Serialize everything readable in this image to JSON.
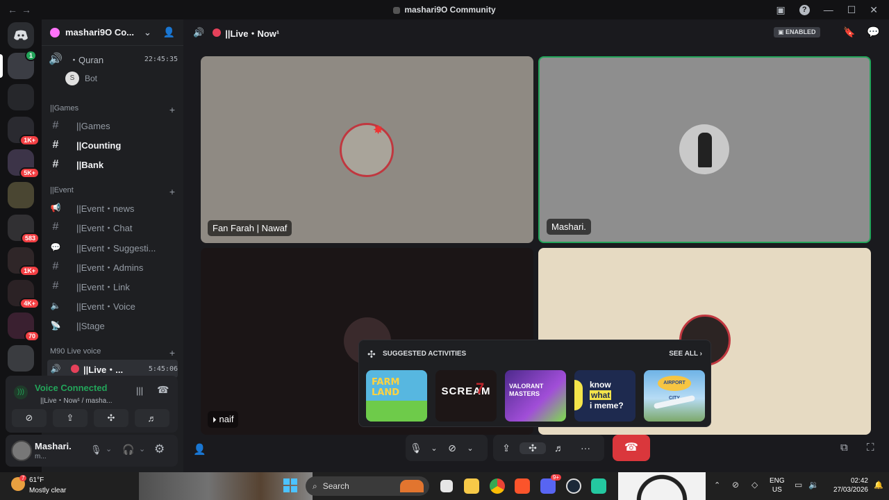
{
  "window": {
    "title": "mashari9O Community",
    "back": "←",
    "forward": "→"
  },
  "titlebar_icons": [
    "inbox-icon",
    "help-icon",
    "minimize-icon",
    "maximize-icon",
    "close-icon"
  ],
  "server": {
    "name": "mashari9O Co..."
  },
  "rail": {
    "badges": [
      "1K+",
      "5K+",
      "583",
      "1K+",
      "4K+",
      "70"
    ],
    "top_badge": "1"
  },
  "channels": {
    "quran": {
      "label": "・Quran",
      "time": "22:45:35",
      "bot_name": "Bot"
    },
    "games_cat": "||Games",
    "games": [
      {
        "label": "||Games",
        "active": false
      },
      {
        "label": "||Counting",
        "active": true
      },
      {
        "label": "||Bank",
        "active": true
      }
    ],
    "event_cat": "||Event",
    "event": [
      {
        "label": "||Event・news"
      },
      {
        "label": "||Event・Chat"
      },
      {
        "label": "||Event・Suggesti..."
      },
      {
        "label": "||Event・Admins"
      },
      {
        "label": "||Event・Link"
      },
      {
        "label": "||Event・Voice"
      },
      {
        "label": "||Stage"
      }
    ],
    "live_cat": "M90 Live voice",
    "live": {
      "label": "||Live・...",
      "time": "5:45:06"
    }
  },
  "voice_panel": {
    "status": "Voice Connected",
    "sub": "||Live・Now¹ / masha..."
  },
  "user": {
    "name": "Mashari.",
    "status": "m..."
  },
  "header": {
    "channel": "||Live・Now¹",
    "enabled_label": "ENABLED"
  },
  "tiles": [
    {
      "name": "Fan Farah | Nawaf",
      "bg": "#8f8a83"
    },
    {
      "name": "Mashari.",
      "bg": "#8e8e8e"
    },
    {
      "name": "naif",
      "bg": "#1b1516"
    },
    {
      "name": "",
      "bg": "#e6dac2"
    }
  ],
  "activities": {
    "title": "SUGGESTED ACTIVITIES",
    "see_all": "SEE ALL",
    "items": [
      {
        "name": "Farm Land",
        "color": "#57b7e0"
      },
      {
        "name": "SCREAM 7",
        "color": "#1d1616"
      },
      {
        "name": "VALORANT MASTERS",
        "color": "#7a3bb6"
      },
      {
        "name": "know what i meme?",
        "color": "#1e2a4f"
      },
      {
        "name": "AIRPORT CITY",
        "color": "#6fb3e6"
      }
    ],
    "meme_text": "know what i meme?"
  },
  "taskbar": {
    "weather_temp": "61°F",
    "weather_desc": "Mostly clear",
    "search": "Search",
    "lang1": "ENG",
    "lang2": "US",
    "time": "02:42",
    "date": "27/03/2026",
    "weather_badge": "7",
    "discord_badge": "9+"
  }
}
